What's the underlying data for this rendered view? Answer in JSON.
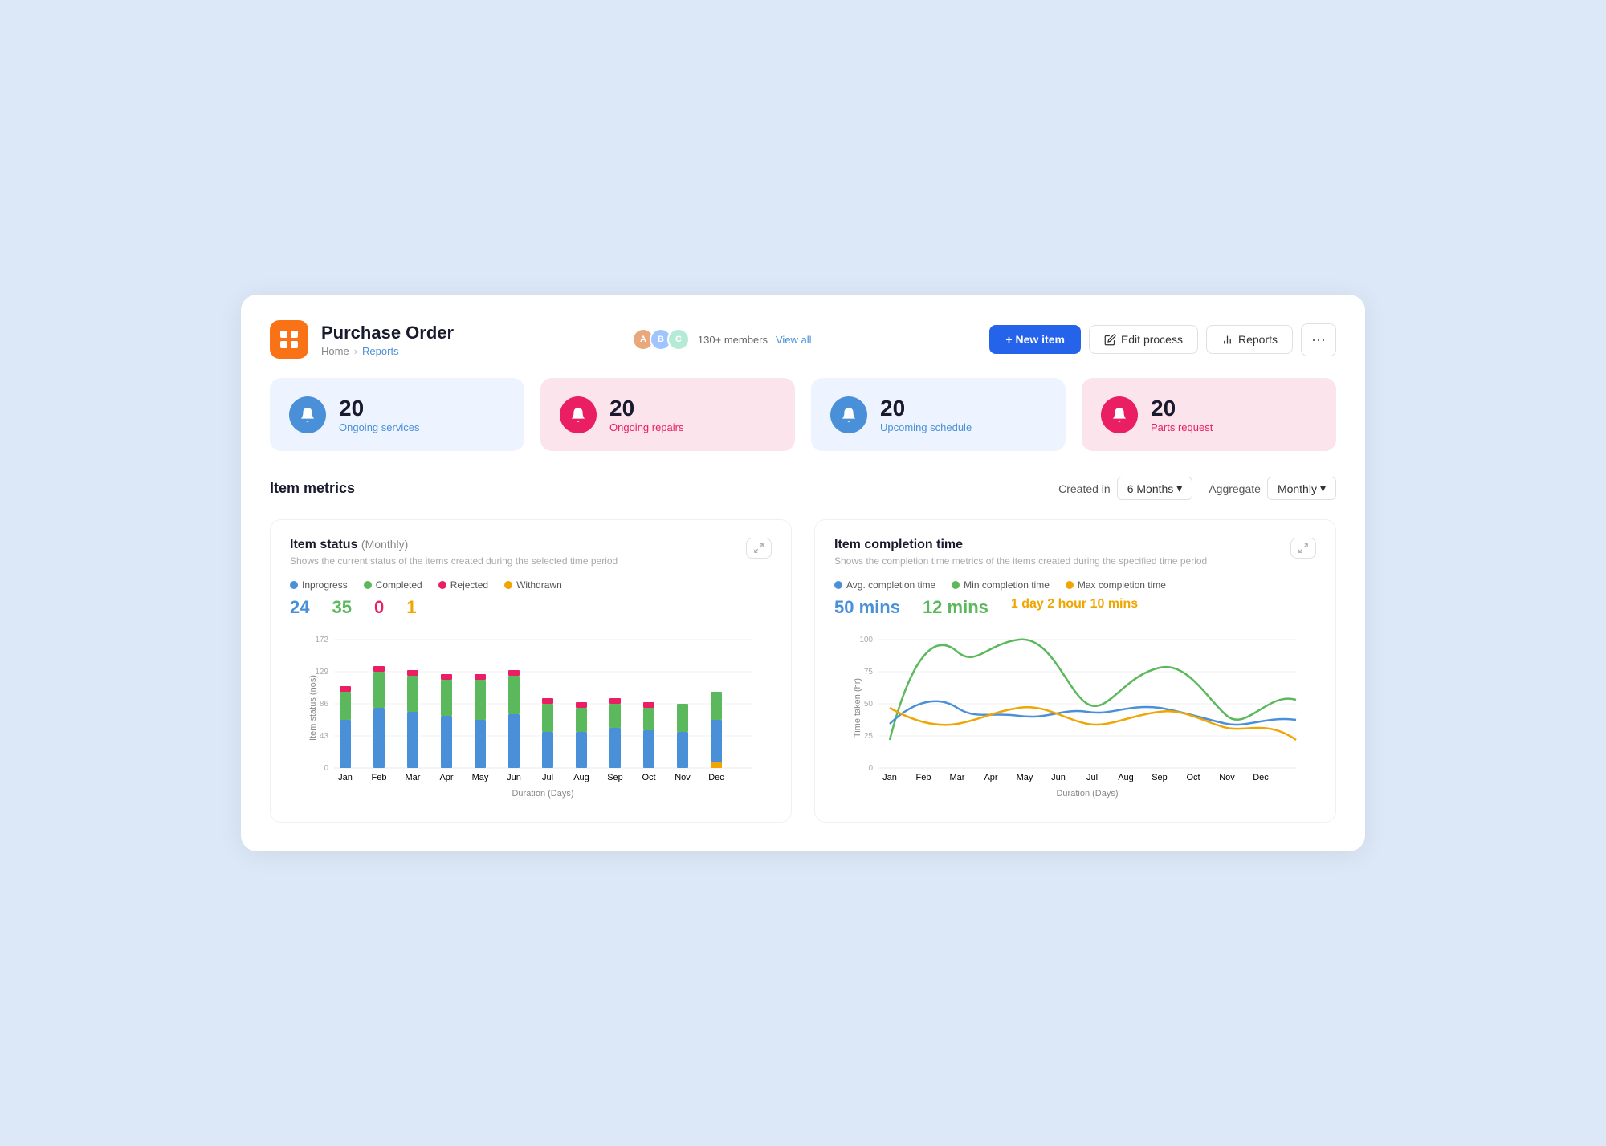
{
  "header": {
    "app_name": "Purchase Order",
    "logo_alt": "purchase-order-logo",
    "breadcrumb_home": "Home",
    "breadcrumb_active": "Reports",
    "members_count": "130+ members",
    "view_all_label": "View all",
    "new_item_label": "+ New item",
    "edit_process_label": "Edit process",
    "reports_label": "Reports",
    "more_label": "···"
  },
  "stats": [
    {
      "num": "20",
      "label": "Ongoing services",
      "icon_type": "bell",
      "theme": "blue"
    },
    {
      "num": "20",
      "label": "Ongoing repairs",
      "icon_type": "bell",
      "theme": "pink"
    },
    {
      "num": "20",
      "label": "Upcoming schedule",
      "icon_type": "bell",
      "theme": "blue"
    },
    {
      "num": "20",
      "label": "Parts request",
      "icon_type": "bell",
      "theme": "pink"
    }
  ],
  "metrics": {
    "title": "Item metrics",
    "created_in_label": "Created in",
    "created_in_value": "6 Months",
    "aggregate_label": "Aggregate",
    "aggregate_value": "Monthly"
  },
  "item_status_chart": {
    "title": "Item status",
    "period": "(Monthly)",
    "description": "Shows the current status of the items created during the selected time period",
    "legend": [
      {
        "label": "Inprogress",
        "color": "#4a90d9"
      },
      {
        "label": "Completed",
        "color": "#5cb85c"
      },
      {
        "label": "Rejected",
        "color": "#e91e63"
      },
      {
        "label": "Withdrawn",
        "color": "#f0a500"
      }
    ],
    "stats": [
      {
        "label": "Inprogress",
        "value": "24",
        "color": "#4a90d9"
      },
      {
        "label": "Completed",
        "value": "35",
        "color": "#5cb85c"
      },
      {
        "label": "Rejected",
        "value": "0",
        "color": "#e91e63"
      },
      {
        "label": "Withdrawn",
        "value": "1",
        "color": "#f0a500"
      }
    ],
    "y_label": "Item status (nos)",
    "x_label": "Duration (Days)",
    "y_ticks": [
      "172",
      "129",
      "86",
      "43",
      "0"
    ],
    "x_ticks": [
      "Jan",
      "Feb",
      "Mar",
      "Apr",
      "May",
      "Jun",
      "Jul",
      "Aug",
      "Sep",
      "Oct",
      "Nov",
      "Dec"
    ]
  },
  "completion_time_chart": {
    "title": "Item completion time",
    "description": "Shows the completion time metrics of the items created during the specified time period",
    "legend": [
      {
        "label": "Avg. completion time",
        "color": "#4a90d9"
      },
      {
        "label": "Min completion time",
        "color": "#5cb85c"
      },
      {
        "label": "Max completion time",
        "color": "#f0a500"
      }
    ],
    "stats": [
      {
        "label": "Avg. completion time",
        "value": "50 mins",
        "color": "#4a90d9"
      },
      {
        "label": "Min completion time",
        "value": "12 mins",
        "color": "#5cb85c"
      },
      {
        "label": "Max completion time",
        "value": "1 day 2 hour 10 mins",
        "color": "#f0a500"
      }
    ],
    "y_label": "Time taken (hr)",
    "x_label": "Duration (Days)",
    "y_ticks": [
      "100",
      "75",
      "50",
      "25",
      "0"
    ],
    "x_ticks": [
      "Jan",
      "Feb",
      "Mar",
      "Apr",
      "May",
      "Jun",
      "Jul",
      "Aug",
      "Sep",
      "Oct",
      "Nov",
      "Dec"
    ]
  }
}
